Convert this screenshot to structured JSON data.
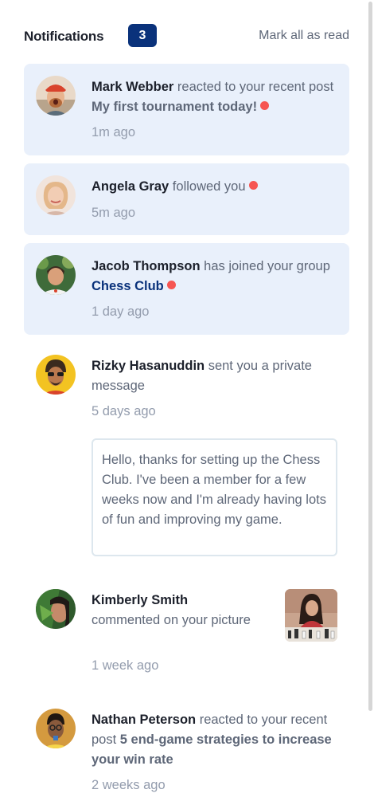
{
  "header": {
    "title": "Notifications",
    "unread_count": "3",
    "mark_all_label": "Mark all as read"
  },
  "notifications": [
    {
      "user": "Mark Webber",
      "action": " reacted to your recent post ",
      "target": "My first tournament today!",
      "time": "1m ago",
      "unread": true
    },
    {
      "user": "Angela Gray",
      "action": " followed you",
      "time": "5m ago",
      "unread": true
    },
    {
      "user": "Jacob Thompson",
      "action": " has joined your group ",
      "target": "Chess Club",
      "time": "1 day ago",
      "unread": true
    },
    {
      "user": "Rizky Hasanuddin",
      "action": " sent you a private message",
      "time": "5 days ago",
      "message": "Hello, thanks for setting up the Chess Club. I've been a member for a few weeks now and I'm already having lots of fun and improving my game.",
      "unread": false
    },
    {
      "user": "Kimberly Smith",
      "action": " commented on your picture",
      "time": "1 week ago",
      "unread": false
    },
    {
      "user": "Nathan Peterson",
      "action": " reacted to your recent post ",
      "target": "5 end-game strategies to increase your win rate",
      "time": "2 weeks ago",
      "unread": false
    }
  ],
  "colors": {
    "unread_bg": "#e9f0fb",
    "badge": "#0a327b",
    "dot": "#f65552",
    "dark_text": "#1c202b",
    "grey_text": "#5e6778",
    "light_text": "#939cad"
  }
}
